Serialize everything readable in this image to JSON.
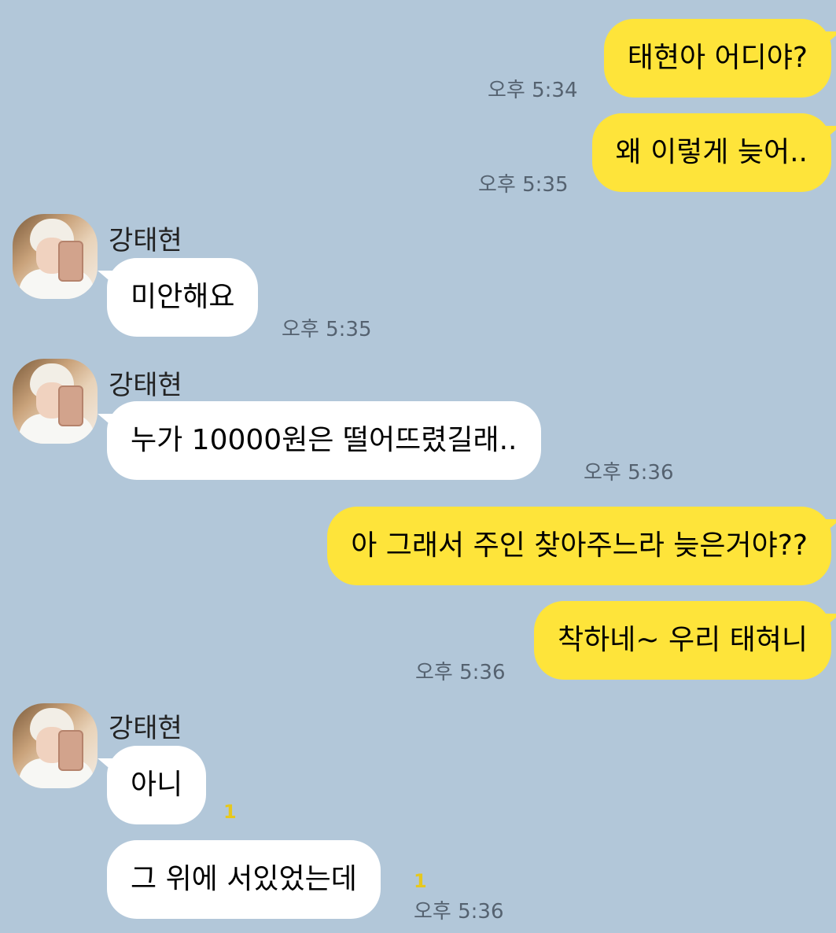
{
  "chat": {
    "contact_name": "강태현",
    "messages": [
      {
        "from": "me",
        "text": "태현아 어디야?",
        "time": "오후 5:34"
      },
      {
        "from": "me",
        "text": "왜 이렇게 늦어..",
        "time": "오후 5:35"
      },
      {
        "from": "them",
        "sender": "강태현",
        "text": "미안해요",
        "time": "오후 5:35"
      },
      {
        "from": "them",
        "sender": "강태현",
        "text": "누가 10000원은 떨어뜨렸길래..",
        "time": "오후 5:36"
      },
      {
        "from": "me",
        "text": "아 그래서 주인 찾아주느라 늦은거야??"
      },
      {
        "from": "me",
        "text": "착하네~ 우리 태혀니",
        "time": "오후 5:36"
      },
      {
        "from": "them",
        "sender": "강태현",
        "text": "아니",
        "unread": "1"
      },
      {
        "from": "them",
        "text": "그 위에 서있었는데",
        "unread": "1",
        "time": "오후 5:36"
      }
    ]
  },
  "colors": {
    "background": "#b2c7d9",
    "my_bubble": "#fee43a",
    "their_bubble": "#ffffff",
    "unread_count": "#e6c81e"
  }
}
